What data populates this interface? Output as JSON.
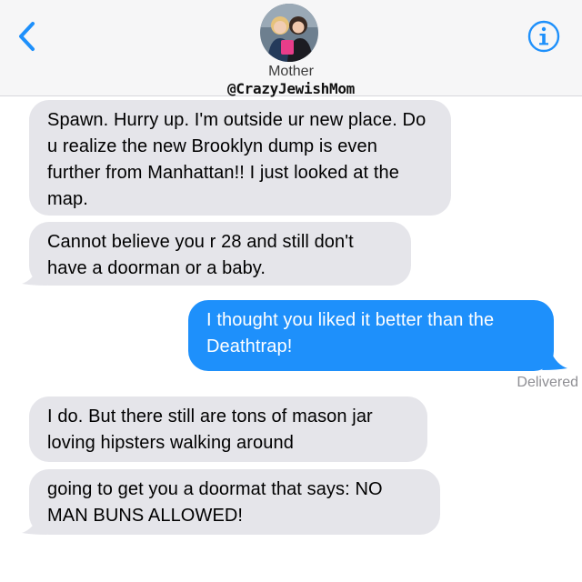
{
  "header": {
    "contact_name": "Mother",
    "caption": "@CrazyJewishMom",
    "back_icon": "chevron-left-icon",
    "info_icon": "info-circle-icon",
    "accent_color": "#1e90fb"
  },
  "messages": [
    {
      "direction": "incoming",
      "text": "Spawn. Hurry up. I'm outside ur new place. Do u realize the new Brooklyn dump is even further from Manhattan!! I just looked at the map."
    },
    {
      "direction": "incoming",
      "text": "Cannot believe you r 28 and still don't have a doorman or a baby."
    },
    {
      "direction": "outgoing",
      "text": "I thought you liked it better than the Deathtrap!"
    },
    {
      "direction": "incoming",
      "text": "I do. But there still are tons of mason jar loving  hipsters walking around"
    },
    {
      "direction": "incoming",
      "text": "going to get you a doormat that says: NO MAN BUNS ALLOWED!"
    }
  ],
  "status": {
    "delivered": "Delivered"
  },
  "colors": {
    "incoming_bubble": "#e5e5ea",
    "outgoing_bubble": "#1e90fb",
    "header_bg": "#f6f6f7"
  }
}
